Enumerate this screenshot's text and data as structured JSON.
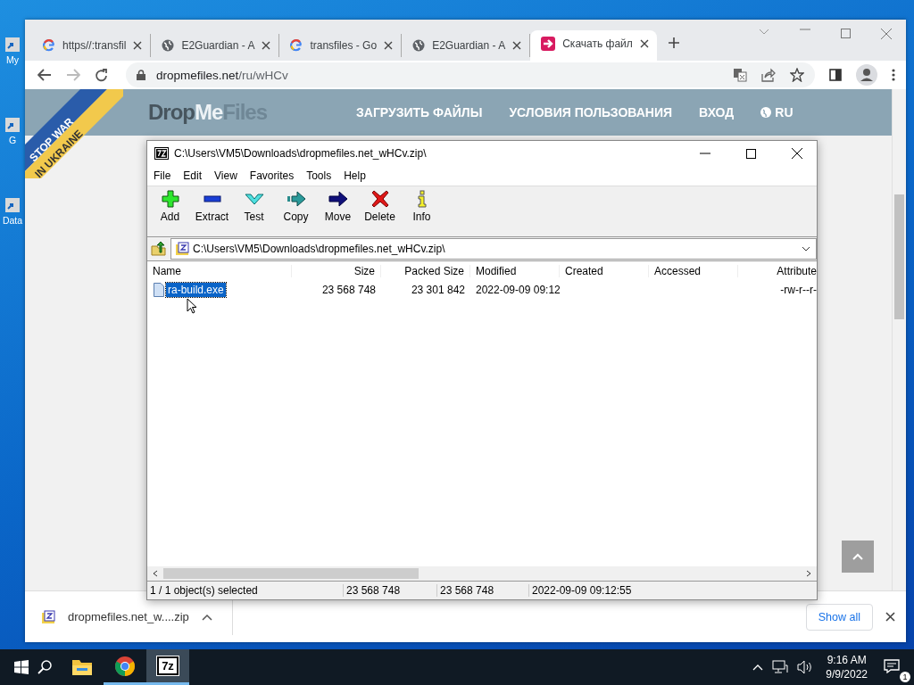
{
  "desktop_icons": [
    {
      "label": "My"
    },
    {
      "label": "G"
    },
    {
      "label": "Data"
    }
  ],
  "browser": {
    "tabs": [
      {
        "title": "https//:transfil",
        "kind": "google",
        "selected": false
      },
      {
        "title": "E2Guardian - A",
        "kind": "globe",
        "selected": false
      },
      {
        "title": "transfiles - Go",
        "kind": "google",
        "selected": false
      },
      {
        "title": "E2Guardian - A",
        "kind": "globe",
        "selected": false
      },
      {
        "title": "Скачать файл",
        "kind": "download",
        "selected": true
      }
    ],
    "address": {
      "host": "dropmefiles.net",
      "path": "/ru/wHCv"
    },
    "site": {
      "logo": [
        "Drop",
        "Me",
        "Files"
      ],
      "nav": [
        "ЗАГРУЗИТЬ ФАЙЛЫ",
        "УСЛОВИЯ ПОЛЬЗОВАНИЯ",
        "ВХОД",
        "RU"
      ],
      "ribbon": [
        "STOP WAR",
        "IN UKRAINE"
      ]
    },
    "download": {
      "file": "dropmefiles.net_w....zip",
      "show_all": "Show all"
    }
  },
  "archiver": {
    "title": "C:\\Users\\VM5\\Downloads\\dropmefiles.net_wHCv.zip\\",
    "menu": [
      "File",
      "Edit",
      "View",
      "Favorites",
      "Tools",
      "Help"
    ],
    "toolbar": [
      {
        "label": "Add",
        "kind": "add"
      },
      {
        "label": "Extract",
        "kind": "extract"
      },
      {
        "label": "Test",
        "kind": "test"
      },
      {
        "label": "Copy",
        "kind": "copy"
      },
      {
        "label": "Move",
        "kind": "move"
      },
      {
        "label": "Delete",
        "kind": "delete"
      },
      {
        "label": "Info",
        "kind": "info"
      }
    ],
    "path": "C:\\Users\\VM5\\Downloads\\dropmefiles.net_wHCv.zip\\",
    "columns": [
      "Name",
      "Size",
      "Packed Size",
      "Modified",
      "Created",
      "Accessed",
      "Attribute"
    ],
    "rows": [
      {
        "name": "ra-build.exe",
        "size": "23 568 748",
        "packed_size": "23 301 842",
        "modified": "2022-09-09 09:12",
        "attributes": "-rw-r--r-",
        "selected": true
      }
    ],
    "status": [
      "1 / 1 object(s) selected",
      "23 568 748",
      "23 568 748",
      "2022-09-09 09:12:55"
    ]
  },
  "taskbar": {
    "apps": [
      {
        "kind": "folder",
        "running": false,
        "selected": false
      },
      {
        "kind": "chrome",
        "running": true,
        "selected": false
      },
      {
        "kind": "archiver",
        "label": "7z",
        "running": true,
        "selected": true
      }
    ],
    "time": "9:16 AM",
    "date": "9/9/2022",
    "notifications": "1"
  }
}
